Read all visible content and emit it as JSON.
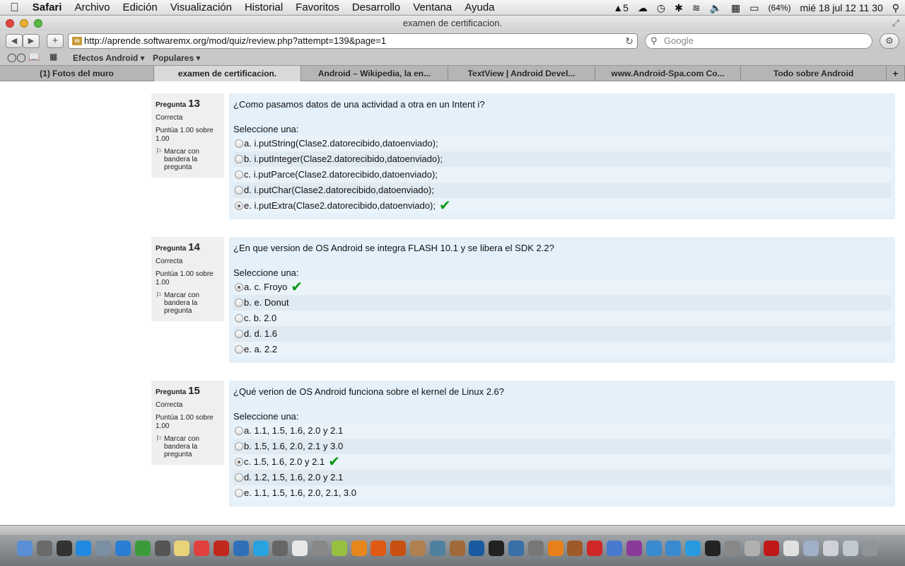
{
  "menubar": {
    "apple": "",
    "items": [
      "Safari",
      "Archivo",
      "Edición",
      "Visualización",
      "Historial",
      "Favoritos",
      "Desarrollo",
      "Ventana",
      "Ayuda"
    ],
    "status": {
      "adobe": "5",
      "battery": "(64%)",
      "clock": "mié 18 jul  12 11 30"
    }
  },
  "window": {
    "title": "examen de certificacion."
  },
  "toolbar": {
    "url": "http://aprende.softwaremx.org/mod/quiz/review.php?attempt=139&page=1",
    "search_placeholder": "Google"
  },
  "bookmarks": {
    "items": [
      "Efectos Android ▾",
      "Populares ▾"
    ]
  },
  "tabs": [
    {
      "label": "(1) Fotos del muro"
    },
    {
      "label": "examen de certificacion."
    },
    {
      "label": "Android – Wikipedia, la en..."
    },
    {
      "label": "TextView | Android Devel..."
    },
    {
      "label": "www.Android-Spa.com Co..."
    },
    {
      "label": "Todo sobre Android"
    }
  ],
  "questions": [
    {
      "label": "Pregunta",
      "number": "13",
      "status": "Correcta",
      "score": "Puntúa 1.00 sobre 1.00",
      "flag": "Marcar con bandera la pregunta",
      "prompt": "¿Como pasamos datos de una actividad a otra en un Intent i?",
      "select": "Seleccione una:",
      "options": [
        "a. i.putString(Clase2.datorecibido,datoenviado);",
        "b.  i.putInteger(Clase2.datorecibido,datoenviado);",
        "c. i.putParce(Clase2.datorecibido,datoenviado);",
        "d.  i.putChar(Clase2.datorecibido,datoenviado);",
        "e. i.putExtra(Clase2.datorecibido,datoenviado);"
      ],
      "selected": 4
    },
    {
      "label": "Pregunta",
      "number": "14",
      "status": "Correcta",
      "score": "Puntúa 1.00 sobre 1.00",
      "flag": "Marcar con bandera la pregunta",
      "prompt": "¿En que version de OS Android se integra FLASH 10.1 y se libera el SDK 2.2?",
      "select": "Seleccione una:",
      "options": [
        "a. c. Froyo",
        "b. e. Donut",
        "c. b. 2.0",
        "d. d. 1.6",
        "e. a. 2.2"
      ],
      "selected": 0
    },
    {
      "label": "Pregunta",
      "number": "15",
      "status": "Correcta",
      "score": "Puntúa 1.00 sobre 1.00",
      "flag": "Marcar con bandera la pregunta",
      "prompt": "¿Qué verion de OS Android funciona sobre el kernel de Linux 2.6?",
      "select": "Seleccione una:",
      "options": [
        "a. 1.1, 1.5, 1.6, 2.0 y 2.1",
        "b. 1.5, 1.6, 2.0, 2.1 y 3.0",
        "c. 1.5, 1.6, 2.0 y 2.1",
        "d. 1.2, 1.5, 1.6, 2.0 y 2.1",
        "e. 1.1, 1.5, 1.6, 2.0, 2.1, 3.0"
      ],
      "selected": 2
    }
  ],
  "dock": {
    "icons": [
      "finder-icon",
      "launchpad-icon",
      "dashboard-icon",
      "app-store-icon",
      "preview-icon",
      "safari-icon",
      "facetime-icon",
      "crossover-icon",
      "notes-icon",
      "ical-icon",
      "filezilla-icon",
      "virtualbox-icon",
      "skype-icon",
      "utility-icon",
      "textedit-icon",
      "photo-icon",
      "android-icon",
      "blender-icon",
      "firefox-icon",
      "illustrator-icon",
      "contacts-icon",
      "camera-icon",
      "gimp-icon",
      "photoshop-icon",
      "unity-icon",
      "virtualbox2-icon",
      "gears-icon",
      "vlc-icon",
      "game-icon",
      "angry-birds-icon",
      "world-icon",
      "eclipse-icon",
      "xcode-icon",
      "itunes-icon",
      "twitter-icon",
      "terminal-icon",
      "system-icon",
      "pencil-icon",
      "flash-icon",
      "doc-icon",
      "folder-icon",
      "mail-icon",
      "window-icon",
      "trash-icon"
    ],
    "colors": [
      "#5a8fd6",
      "#6a6a6a",
      "#333",
      "#1f8ae0",
      "#7b8fa3",
      "#2a7fd4",
      "#3b9b3b",
      "#555",
      "#e8d27a",
      "#e04040",
      "#c0281e",
      "#3070b8",
      "#28a3e0",
      "#666",
      "#e8e8e8",
      "#888",
      "#98c040",
      "#e8861e",
      "#e05a16",
      "#c85010",
      "#b08050",
      "#5080a0",
      "#a06a3a",
      "#1a5aa0",
      "#222",
      "#3a70a8",
      "#777",
      "#e8801a",
      "#a05a2a",
      "#d02828",
      "#4a7ad0",
      "#8a3a9a",
      "#3a8ad0",
      "#3a8ad0",
      "#2a9ae0",
      "#222",
      "#888",
      "#b0b0b0",
      "#c01818",
      "#e0e0e0",
      "#a0b0c8",
      "#d0d0d8",
      "#c0c8d0",
      "#909498"
    ]
  }
}
